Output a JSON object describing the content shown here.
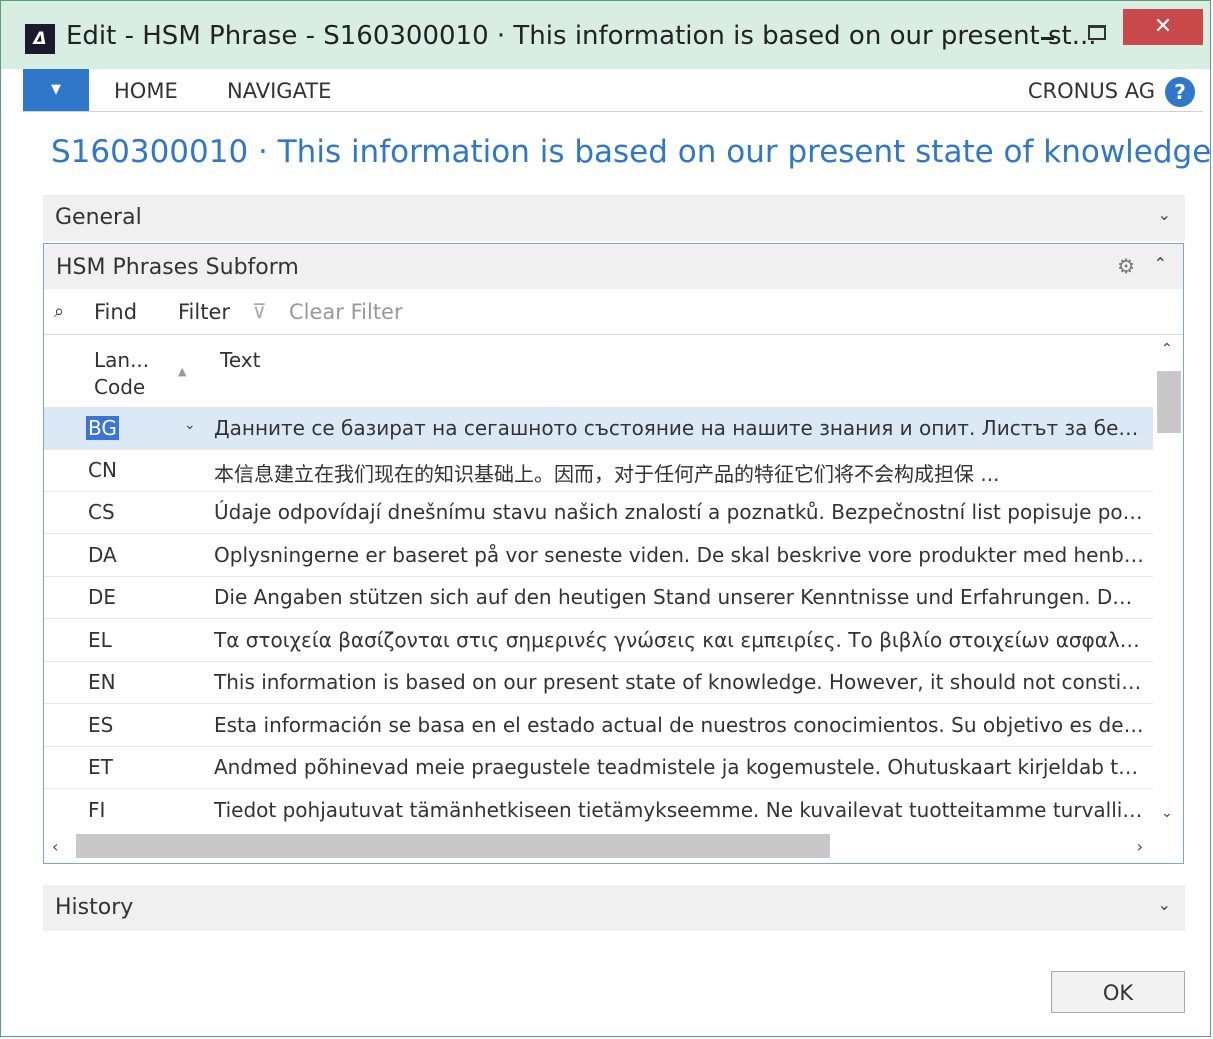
{
  "window": {
    "logo": "Δ",
    "title": "Edit - HSM Phrase - S160300010 · This information is based on our present st...",
    "close": "✕"
  },
  "ribbon": {
    "menu_icon": "▼",
    "tabs": [
      "HOME",
      "NAVIGATE"
    ],
    "company": "CRONUS AG",
    "help": "?"
  },
  "page_title": "S160300010 · This information is based on our present state of knowledge...",
  "general": {
    "title": "General"
  },
  "subform": {
    "title": "HSM Phrases Subform",
    "toolbar": {
      "find": "Find",
      "filter": "Filter",
      "clear_filter": "Clear Filter"
    },
    "columns": {
      "code_line1": "Lan...",
      "code_line2": "Code",
      "text": "Text"
    },
    "rows": [
      {
        "code": "BG",
        "text": "Данните се базират на сегашното състояние на нашите знания и опит. Листът за безопас..."
      },
      {
        "code": "CN",
        "text": "本信息建立在我们现在的知识基础上。因而，对于任何产品的特征它们将不会构成担保 ..."
      },
      {
        "code": "CS",
        "text": "Údaje odpovídají dnešnímu stavu našich znalostí a poznatků. Bezpečnostní list popisuje požad..."
      },
      {
        "code": "DA",
        "text": "Oplysningerne er baseret på vor seneste viden. De skal beskrive vore produkter med henblik p..."
      },
      {
        "code": "DE",
        "text": "Die Angaben stützen sich auf den heutigen Stand unserer Kenntnisse und Erfahrungen. Das Si..."
      },
      {
        "code": "EL",
        "text": "Τα στοιχεία βασίζονται στις σημερινές γνώσεις και εμπειρίες. Το βιβλίο στοιχείων ασφαλείας..."
      },
      {
        "code": "EN",
        "text": "This information is based on our present state of knowledge. However, it should not constitut..."
      },
      {
        "code": "ES",
        "text": "Esta información se basa en el estado actual de nuestros conocimientos. Su objetivo es descri..."
      },
      {
        "code": "ET",
        "text": "Andmed põhinevad meie praegustele teadmistele ja kogemustele. Ohutuskaart kirjeldab toot..."
      },
      {
        "code": "FI",
        "text": "Tiedot pohjautuvat tämänhetkiseen tietämykseemme. Ne kuvailevat tuotteitamme turvallisuu..."
      }
    ]
  },
  "history": {
    "title": "History"
  },
  "ok_label": "OK"
}
